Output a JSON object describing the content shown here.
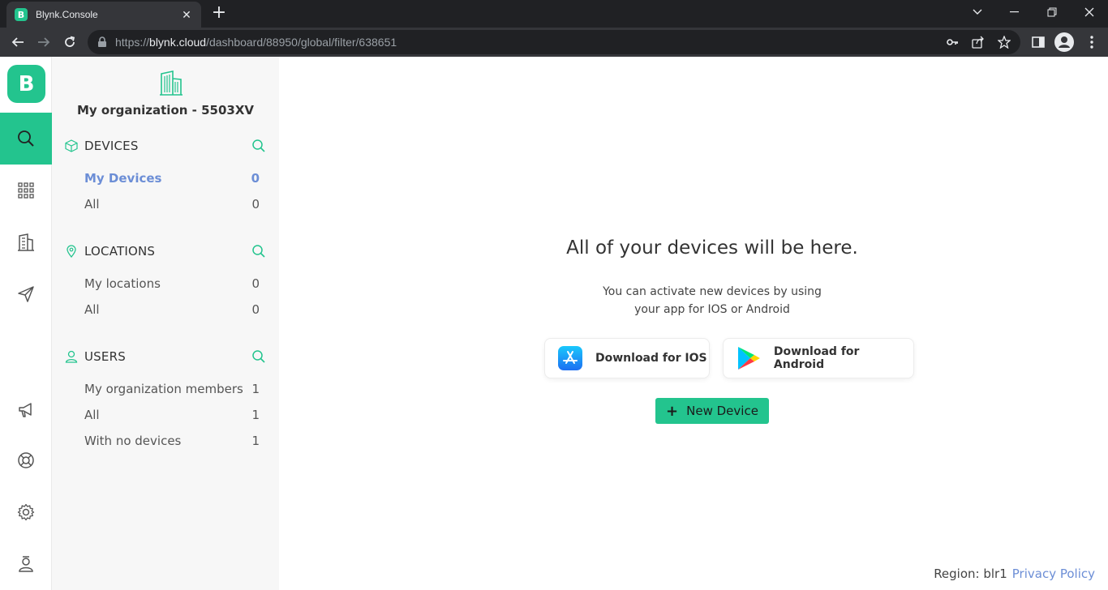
{
  "browser": {
    "tab_title": "Blynk.Console",
    "tab_favicon_letter": "B",
    "url_prefix": "https://",
    "url_host": "blynk.cloud",
    "url_path": "/dashboard/88950/global/filter/638651"
  },
  "rail": {
    "logo_letter": "B",
    "items": [
      "search-icon",
      "apps-grid-icon",
      "building-icon",
      "send-icon",
      "megaphone-icon",
      "lifebuoy-icon",
      "gear-icon",
      "user-badge-icon"
    ],
    "active": "search-icon"
  },
  "panel": {
    "org_name": "My organization - 5503XV",
    "devices": {
      "title": "DEVICES",
      "rows": [
        {
          "label": "My Devices",
          "count": "0"
        },
        {
          "label": "All",
          "count": "0"
        }
      ]
    },
    "locations": {
      "title": "LOCATIONS",
      "rows": [
        {
          "label": "My locations",
          "count": "0"
        },
        {
          "label": "All",
          "count": "0"
        }
      ]
    },
    "users": {
      "title": "USERS",
      "rows": [
        {
          "label": "My organization members",
          "count": "1"
        },
        {
          "label": "All",
          "count": "1"
        },
        {
          "label": "With no devices",
          "count": "1"
        }
      ]
    }
  },
  "main": {
    "title": "All of your devices will be here.",
    "subtitle_line1": "You can activate new devices by using",
    "subtitle_line2": "your app for IOS or Android",
    "ios_button": "Download for IOS",
    "android_button": "Download for Android",
    "new_device_button": "New Device",
    "region_label": "Region: blr1",
    "privacy_link": "Privacy Policy"
  },
  "colors": {
    "brand_green": "#23c48e",
    "active_link": "#6c8ed6"
  }
}
